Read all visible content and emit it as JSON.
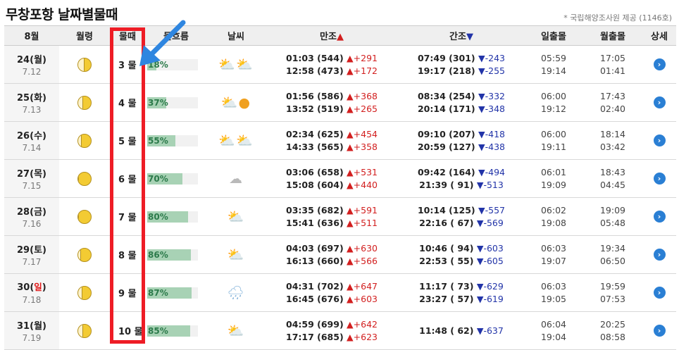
{
  "page": {
    "title": "무창포항 날짜별물때",
    "source": "* 국립해양조사원 제공 (1146호)"
  },
  "headers": {
    "month": "8월",
    "moon": "월령",
    "mul": "물때",
    "flow": "물흐름",
    "weather": "날씨",
    "high": "만조",
    "high_tri": "▲",
    "low": "간조",
    "low_tri": "▼",
    "sunrise": "일출몰",
    "moonrise": "월출몰",
    "detail": "상세"
  },
  "colors": {
    "highlight": "#ee1c25",
    "arrow": "#2f86e0",
    "up": "#d21f1f",
    "down": "#2234a8",
    "bar": "#a8d2b5"
  },
  "rows": [
    {
      "day": "24(",
      "wk": "월",
      "close": ")",
      "lunar": "7.12",
      "moon_phase": 0.45,
      "mul": "3 물",
      "flow": 18,
      "flow_label": "18%",
      "weather": [
        "cloudy-sunny-icon",
        "cloudy-sunny-icon"
      ],
      "high1": "01:03 (544)",
      "high1d": "▲+291",
      "high2": "12:58 (473)",
      "high2d": "▲+172",
      "low1": "07:49 (301)",
      "low1d": "▼-243",
      "low2": "19:17 (218)",
      "low2d": "▼-255",
      "sun1": "05:59",
      "sun2": "19:14",
      "moon1": "17:05",
      "moon2": "01:41"
    },
    {
      "day": "25(",
      "wk": "화",
      "close": ")",
      "lunar": "7.13",
      "moon_phase": 0.35,
      "mul": "4 물",
      "flow": 37,
      "flow_label": "37%",
      "weather": [
        "cloudy-sunny-icon",
        "sunny-icon"
      ],
      "high1": "01:56 (586)",
      "high1d": "▲+368",
      "high2": "13:52 (519)",
      "high2d": "▲+265",
      "low1": "08:34 (254)",
      "low1d": "▼-332",
      "low2": "20:14 (171)",
      "low2d": "▼-348",
      "sun1": "06:00",
      "sun2": "19:12",
      "moon1": "17:43",
      "moon2": "02:40"
    },
    {
      "day": "26(",
      "wk": "수",
      "close": ")",
      "lunar": "7.14",
      "moon_phase": 0.2,
      "mul": "5 물",
      "flow": 55,
      "flow_label": "55%",
      "weather": [
        "cloudy-sunny-icon",
        "cloudy-sunny-icon"
      ],
      "high1": "02:34 (625)",
      "high1d": "▲+454",
      "high2": "14:33 (565)",
      "high2d": "▲+358",
      "low1": "09:10 (207)",
      "low1d": "▼-418",
      "low2": "20:59 (127)",
      "low2d": "▼-438",
      "sun1": "06:00",
      "sun2": "19:11",
      "moon1": "18:14",
      "moon2": "03:42"
    },
    {
      "day": "27(",
      "wk": "목",
      "close": ")",
      "lunar": "7.15",
      "moon_phase": 0,
      "mul": "6 물",
      "flow": 70,
      "flow_label": "70%",
      "weather": [
        "cloudy-icon"
      ],
      "high1": "03:06 (658)",
      "high1d": "▲+531",
      "high2": "15:08 (604)",
      "high2d": "▲+440",
      "low1": "09:42 (164)",
      "low1d": "▼-494",
      "low2": "21:39 ( 91)",
      "low2d": "▼-513",
      "sun1": "06:01",
      "sun2": "19:09",
      "moon1": "18:43",
      "moon2": "04:45"
    },
    {
      "day": "28(",
      "wk": "금",
      "close": ")",
      "lunar": "7.16",
      "moon_phase": 0,
      "mul": "7 물",
      "flow": 80,
      "flow_label": "80%",
      "weather": [
        "cloudy-sunny-icon"
      ],
      "high1": "03:35 (682)",
      "high1d": "▲+591",
      "high2": "15:41 (636)",
      "high2d": "▲+511",
      "low1": "10:14 (125)",
      "low1d": "▼-557",
      "low2": "22:16 ( 67)",
      "low2d": "▼-569",
      "sun1": "06:02",
      "sun2": "19:08",
      "moon1": "19:09",
      "moon2": "05:48"
    },
    {
      "day": "29(",
      "wk": "토",
      "close": ")",
      "lunar": "7.17",
      "moon_phase": 0.15,
      "mul": "8 물",
      "flow": 86,
      "flow_label": "86%",
      "weather": [
        "cloudy-sunny-icon"
      ],
      "high1": "04:03 (697)",
      "high1d": "▲+630",
      "high2": "16:13 (660)",
      "high2d": "▲+566",
      "low1": "10:46 ( 94)",
      "low1d": "▼-603",
      "low2": "22:53 ( 55)",
      "low2d": "▼-605",
      "sun1": "06:03",
      "sun2": "19:07",
      "moon1": "19:34",
      "moon2": "06:50"
    },
    {
      "day": "30(",
      "wk": "일",
      "close": ")",
      "lunar": "7.18",
      "moon_phase": 0.25,
      "mul": "9 물",
      "flow": 87,
      "flow_label": "87%",
      "weather": [
        "rain-icon"
      ],
      "high1": "04:31 (702)",
      "high1d": "▲+647",
      "high2": "16:45 (676)",
      "high2d": "▲+603",
      "low1": "11:17 ( 73)",
      "low1d": "▼-629",
      "low2": "23:27 ( 57)",
      "low2d": "▼-619",
      "sun1": "06:03",
      "sun2": "19:05",
      "moon1": "19:59",
      "moon2": "07:53"
    },
    {
      "day": "31(",
      "wk": "월",
      "close": ")",
      "lunar": "7.19",
      "moon_phase": 0.35,
      "mul": "10 물",
      "flow": 85,
      "flow_label": "85%",
      "weather": [
        "cloudy-sunny-icon"
      ],
      "high1": "04:59 (699)",
      "high1d": "▲+642",
      "high2": "17:17 (685)",
      "high2d": "▲+623",
      "low1": "11:48 ( 62)",
      "low1d": "▼-637",
      "low2": "",
      "low2d": "",
      "sun1": "06:04",
      "sun2": "19:04",
      "moon1": "20:25",
      "moon2": "08:58"
    }
  ]
}
